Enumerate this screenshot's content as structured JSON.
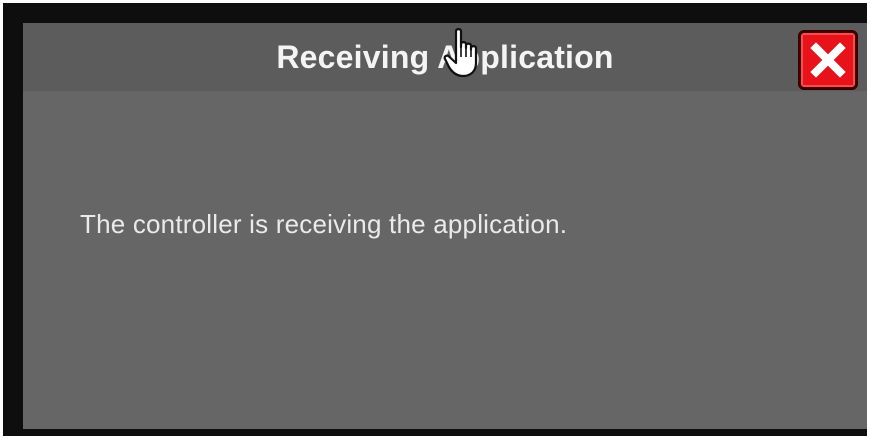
{
  "dialog": {
    "title": "Receiving Application",
    "message": "The controller is receiving the application.",
    "close_icon": "close-icon"
  },
  "cursor": {
    "icon": "hand-pointer-icon"
  },
  "colors": {
    "frame": "#0e0e0e",
    "dialog_background": "#666666",
    "titlebar_background": "#5c5c5c",
    "close_button": "#e8131a",
    "text": "#f4f4f4"
  }
}
